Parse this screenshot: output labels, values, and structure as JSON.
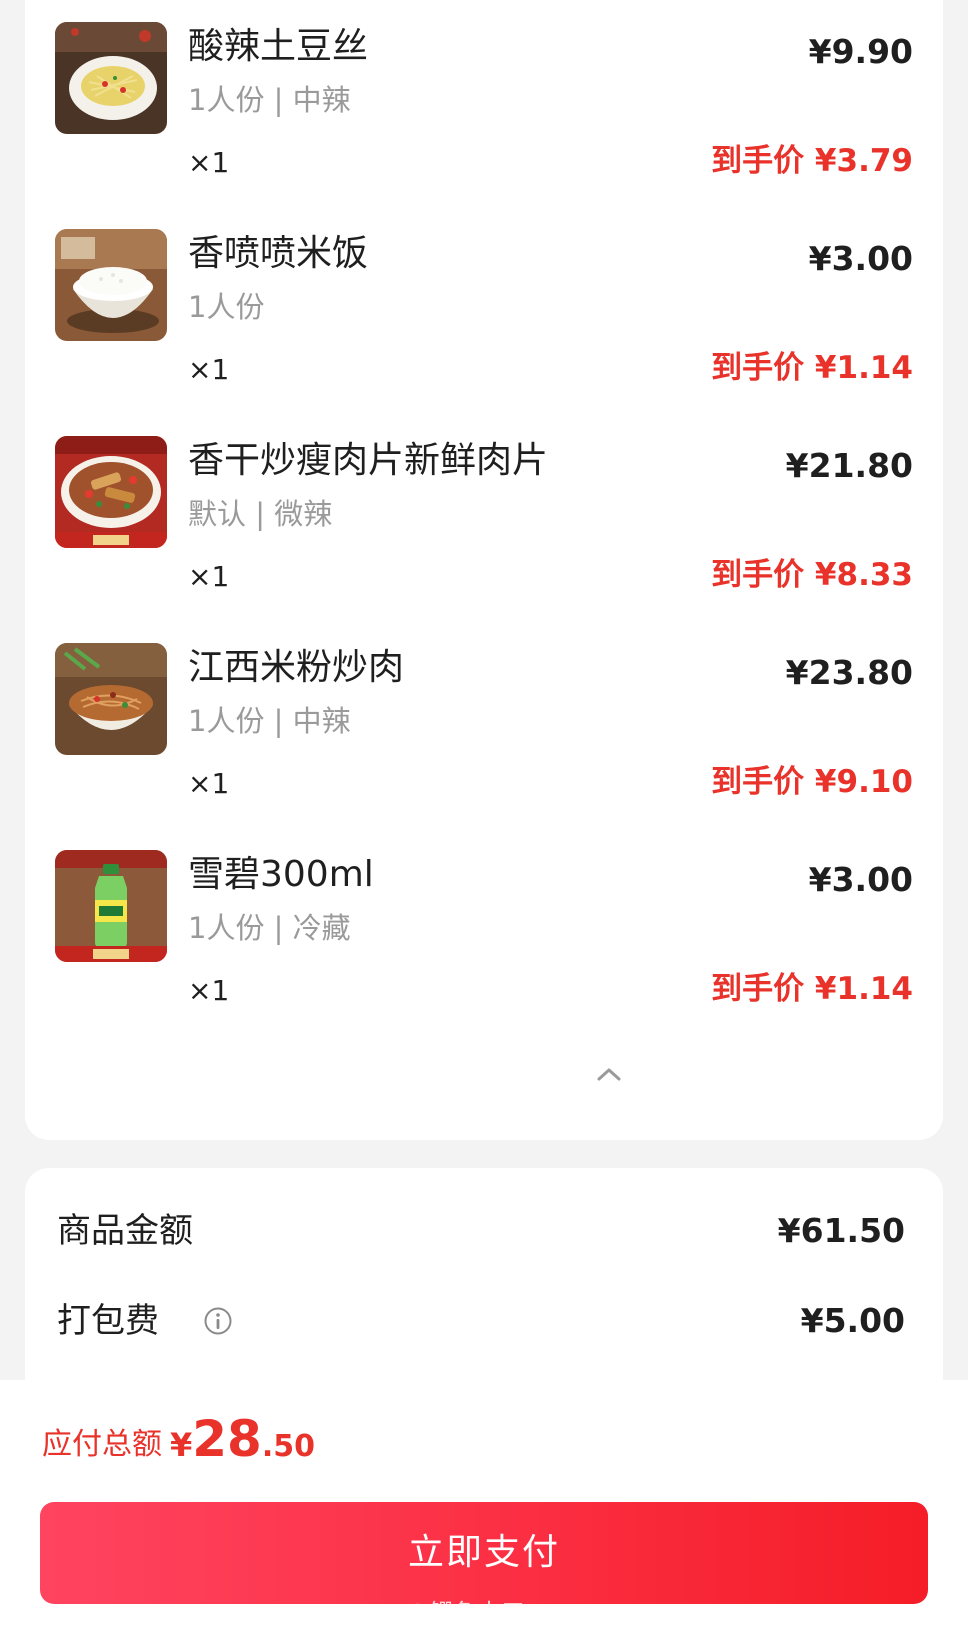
{
  "items": [
    {
      "name": "酸辣土豆丝",
      "spec": "1人份 | 中辣",
      "qty": "×1",
      "price": "¥9.90",
      "final_price": "到手价 ¥3.79",
      "image": "shredded-potato-dish"
    },
    {
      "name": "香喷喷米饭",
      "spec": "1人份",
      "qty": "×1",
      "price": "¥3.00",
      "final_price": "到手价 ¥1.14",
      "image": "rice-bowl"
    },
    {
      "name": "香干炒瘦肉片新鲜肉片",
      "spec": "默认 | 微辣",
      "qty": "×1",
      "price": "¥21.80",
      "final_price": "到手价 ¥8.33",
      "image": "stir-fried-pork-dish"
    },
    {
      "name": "江西米粉炒肉",
      "spec": "1人份 | 中辣",
      "qty": "×1",
      "price": "¥23.80",
      "final_price": "到手价 ¥9.10",
      "image": "rice-noodle-dish"
    },
    {
      "name": "雪碧300ml",
      "spec": "1人份 | 冷藏",
      "qty": "×1",
      "price": "¥3.00",
      "final_price": "到手价 ¥1.14",
      "image": "sprite-bottle"
    }
  ],
  "summary": {
    "goods_label": "商品金额",
    "goods_value": "¥61.50",
    "packing_label": "打包费",
    "packing_value": "¥5.00"
  },
  "total": {
    "label": "应付总额",
    "symbol": "¥",
    "integer": "28",
    "decimal": ".50"
  },
  "pay_button_label": "立即支付",
  "watermark": "@鳄鱼十三",
  "colors": {
    "accent_red": "#e8322a",
    "pay_button": "#fb2e42",
    "background": "#f3f3f3"
  }
}
